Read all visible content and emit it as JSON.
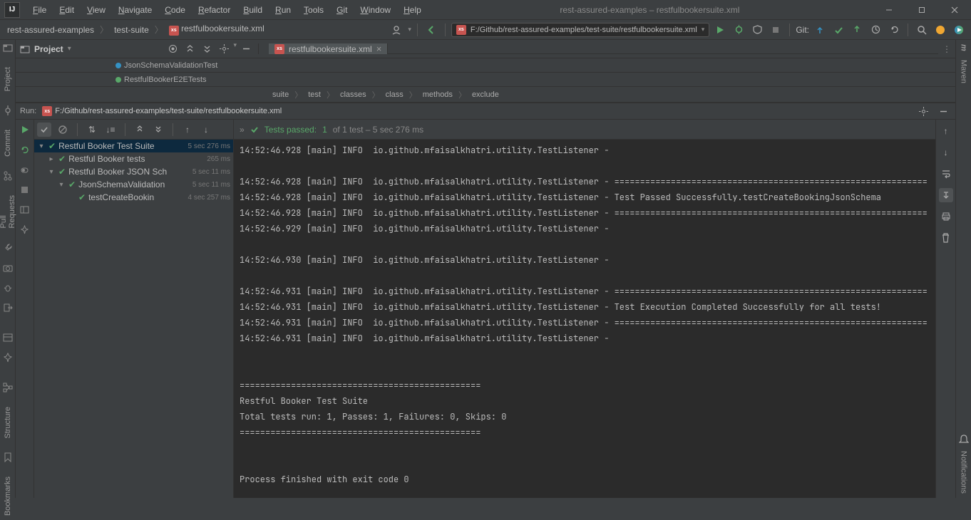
{
  "menus": [
    "File",
    "Edit",
    "View",
    "Navigate",
    "Code",
    "Refactor",
    "Build",
    "Run",
    "Tools",
    "Git",
    "Window",
    "Help"
  ],
  "menu_underlines": [
    "F",
    "E",
    "V",
    "N",
    "C",
    "R",
    "B",
    "u",
    "T",
    "t",
    "W",
    "H"
  ],
  "title": "rest-assured-examples – restfulbookersuite.xml",
  "breadcrumb": [
    "rest-assured-examples",
    "test-suite",
    "restfulbookersuite.xml"
  ],
  "run_config_path": "F:/Github/rest-assured-examples/test-suite/restfulbookersuite.xml",
  "git_label": "Git:",
  "project_label": "Project",
  "editor_tab": "restfulbookersuite.xml",
  "project_files": [
    "JsonSchemaValidationTest",
    "RestfulBookerE2ETests"
  ],
  "structure_path": [
    "suite",
    "test",
    "classes",
    "class",
    "methods",
    "exclude"
  ],
  "run_label": "Run:",
  "run_path": "F:/Github/rest-assured-examples/test-suite/restfulbookersuite.xml",
  "tests_status_prefix": "Tests passed:",
  "tests_status_count": "1",
  "tests_status_suffix": "of 1 test – 5 sec 276 ms",
  "tree": [
    {
      "level": 0,
      "expanded": true,
      "name": "Restful Booker Test Suite",
      "time": "5 sec 276 ms",
      "sel": true
    },
    {
      "level": 1,
      "expanded": false,
      "name": "Restful Booker tests",
      "time": "265 ms"
    },
    {
      "level": 1,
      "expanded": true,
      "name": "Restful Booker JSON Sch",
      "time": "5 sec 11 ms"
    },
    {
      "level": 2,
      "expanded": true,
      "name": "JsonSchemaValidation",
      "time": "5 sec 11 ms"
    },
    {
      "level": 3,
      "expanded": false,
      "name": "testCreateBookin",
      "time": "4 sec 257 ms"
    }
  ],
  "console_lines": [
    "14:52:46.928 [main] INFO  io.github.mfaisalkhatri.utility.TestListener -",
    "",
    "14:52:46.928 [main] INFO  io.github.mfaisalkhatri.utility.TestListener - =============================================================",
    "14:52:46.928 [main] INFO  io.github.mfaisalkhatri.utility.TestListener - Test Passed Successfully.testCreateBookingJsonSchema",
    "14:52:46.928 [main] INFO  io.github.mfaisalkhatri.utility.TestListener - =============================================================",
    "14:52:46.929 [main] INFO  io.github.mfaisalkhatri.utility.TestListener -",
    "",
    "14:52:46.930 [main] INFO  io.github.mfaisalkhatri.utility.TestListener -",
    "",
    "14:52:46.931 [main] INFO  io.github.mfaisalkhatri.utility.TestListener - =============================================================",
    "14:52:46.931 [main] INFO  io.github.mfaisalkhatri.utility.TestListener - Test Execution Completed Successfully for all tests!",
    "14:52:46.931 [main] INFO  io.github.mfaisalkhatri.utility.TestListener - =============================================================",
    "14:52:46.931 [main] INFO  io.github.mfaisalkhatri.utility.TestListener -",
    "",
    "",
    "===============================================",
    "Restful Booker Test Suite",
    "Total tests run: 1, Passes: 1, Failures: 0, Skips: 0",
    "===============================================",
    "",
    "",
    "Process finished with exit code 0"
  ],
  "left_labels": {
    "project": "Project",
    "commit": "Commit",
    "pull": "Pull Requests",
    "structure": "Structure",
    "bookmarks": "Bookmarks"
  },
  "right_labels": {
    "maven": "Maven",
    "notifications": "Notifications"
  }
}
